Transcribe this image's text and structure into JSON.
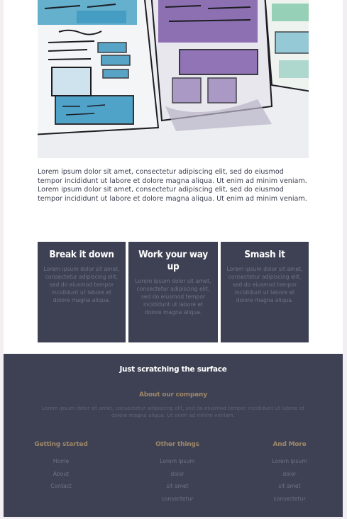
{
  "intro_text": "Lorem ipsum dolor sit amet, consectetur adipiscing elit, sed do eiusmod tempor incididunt ut labore et dolore magna aliqua. Ut enim ad minim veniam. Lorem ipsum dolor sit amet, consectetur adipiscing elit, sed do eiusmod tempor incididunt ut labore et dolore magna aliqua. Ut enim ad minim veniam.",
  "cards": [
    {
      "title": "Break it down",
      "text": "Lorem ipsum dolor sit amet, consectetur adipiscing elit, sed do eiusmod tempor incididunt ut labore et dolore magna aliqua."
    },
    {
      "title": "Work your way up",
      "text": "Lorem ipsum dolor sit amet, consectetur adipiscing elit, sed do eiusmod tempor incididunt ut labore et dolore magna aliqua."
    },
    {
      "title": "Smash it",
      "text": "Lorem ipsum dolor sit amet, consectetur adipiscing elit, sed do eiusmod tempor incididunt ut labore et dolore magna aliqua."
    }
  ],
  "footer": {
    "heading": "Just scratching the surface",
    "about_title": "About our company",
    "about_text": "Lorem ipsum dolor sit amet, consectetur adipiscing elit, sed do eiusmod tempor incididunt ut labore et dolore magna aliqua. Ut enim ad minim veniam.",
    "columns": [
      {
        "title": "Getting started",
        "links": [
          "Home",
          "About",
          "Contact"
        ]
      },
      {
        "title": "Other things",
        "links": [
          "Lorem ipsum",
          "dolor",
          "sit amet",
          "consectetur"
        ]
      },
      {
        "title": "And More",
        "links": [
          "Lorem ipsum",
          "dolor",
          "sit amet",
          "consectetur"
        ]
      }
    ]
  },
  "colors": {
    "card_bg": "#3e4153",
    "accent_gold": "#9e8869",
    "body_text": "#3b3e4f"
  }
}
